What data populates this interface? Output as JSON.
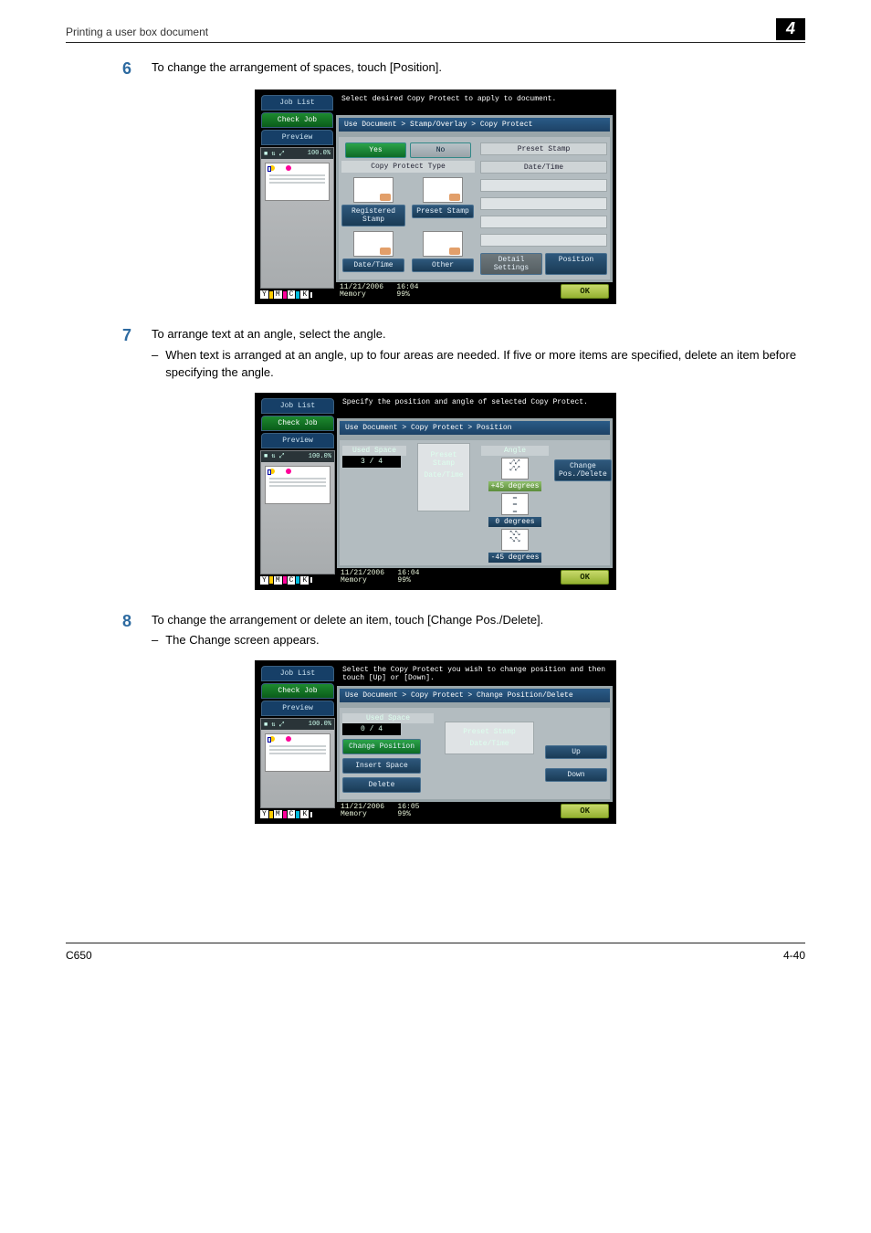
{
  "header": {
    "title": "Printing a user box document",
    "chapter": "4"
  },
  "steps": [
    {
      "num": "6",
      "text": "To change the arrangement of spaces, touch [Position]."
    },
    {
      "num": "7",
      "text": "To arrange text at an angle, select the angle.",
      "sub": "When text is arranged at an angle, up to four areas are needed. If five or more items are specified, delete an item before specifying the angle."
    },
    {
      "num": "8",
      "text": "To change the arrangement or delete an item, touch [Change Pos./Delete].",
      "sub": "The Change screen appears."
    }
  ],
  "shot_common": {
    "tabs": {
      "job_list": "Job List",
      "check_job": "Check Job",
      "preview": "Preview"
    },
    "zoom": "100.0%",
    "footer": {
      "date": "11/21/2006",
      "memory": "Memory",
      "ok": "OK"
    }
  },
  "shot1": {
    "msg": "Select desired Copy Protect to apply to document.",
    "breadcrumb": "Use Document > Stamp/Overlay > Copy Protect",
    "yes": "Yes",
    "no": "No",
    "section": "Copy Protect Type",
    "tiles": [
      "Registered Stamp",
      "Preset Stamp",
      "Date/Time",
      "Other"
    ],
    "right_labels": [
      "Preset Stamp",
      "Date/Time"
    ],
    "detail": "Detail Settings",
    "position": "Position",
    "time": "16:04",
    "mem_pct": "99%"
  },
  "shot2": {
    "msg": "Specify the position and angle of selected Copy Protect.",
    "breadcrumb": "Use Document > Copy Protect > Position",
    "used_space": "Used Space",
    "used_val": "3  /  4",
    "infos": [
      "Preset Stamp",
      "Date/Time"
    ],
    "angle": "Angle",
    "angles": [
      "+45 degrees",
      "0 degrees",
      "-45 degrees"
    ],
    "change": "Change Pos./Delete",
    "time": "16:04",
    "mem_pct": "99%"
  },
  "shot3": {
    "msg": "Select the Copy Protect you wish to change position and then touch [Up] or [Down].",
    "breadcrumb": "Use Document > Copy Protect > Change Position/Delete",
    "used_space": "Used Space",
    "used_val": "0  /  4",
    "btns": [
      "Change Position",
      "Insert Space",
      "Delete"
    ],
    "infos": [
      "Preset Stamp",
      "Date/Time"
    ],
    "up": "Up",
    "down": "Down",
    "time": "16:05",
    "mem_pct": "99%"
  },
  "footer": {
    "left": "C650",
    "right": "4-40"
  }
}
